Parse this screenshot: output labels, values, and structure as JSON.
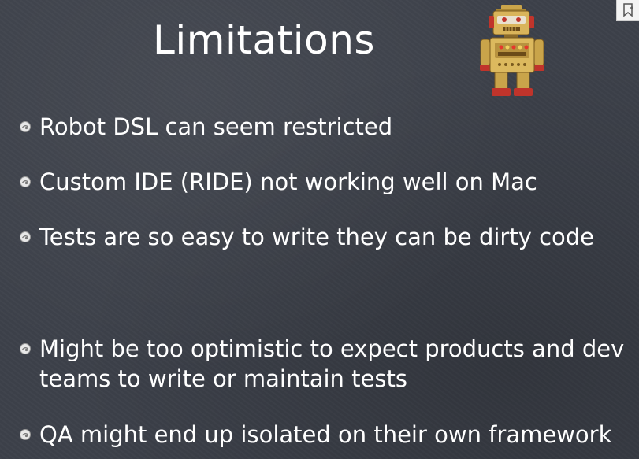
{
  "slide": {
    "title": "Limitations",
    "bullets": [
      "Robot DSL can seem restricted",
      "Custom IDE (RIDE) not working well on Mac",
      "Tests are so easy to write they can be dirty code",
      "Might be too optimistic to expect products and dev teams to write or maintain tests",
      "QA might end up isolated on their own framework"
    ],
    "icons": {
      "robot": "robot-toy-icon",
      "bullet": "bullet-icon",
      "corner": "bookmark-icon"
    }
  }
}
